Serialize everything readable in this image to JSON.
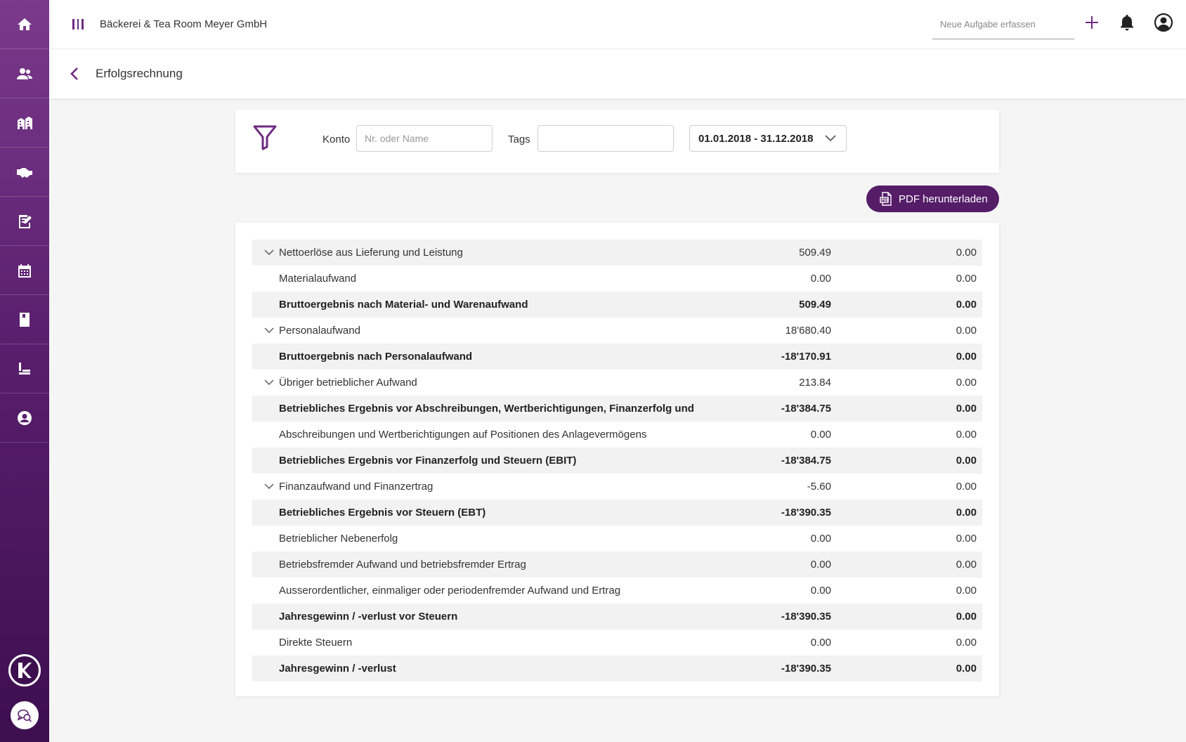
{
  "sidebar": {
    "items": [
      {
        "icon": "home-icon",
        "name": "home"
      },
      {
        "icon": "contacts-icon",
        "name": "contacts"
      },
      {
        "icon": "buildings-icon",
        "name": "companies"
      },
      {
        "icon": "handshake-icon",
        "name": "deals"
      },
      {
        "icon": "tasks-icon",
        "name": "tasks"
      },
      {
        "icon": "calendar-icon",
        "name": "calendar"
      },
      {
        "icon": "book-icon",
        "name": "accounting"
      },
      {
        "icon": "reports-icon",
        "name": "reports"
      },
      {
        "icon": "person-icon",
        "name": "profile"
      }
    ],
    "logo_icon": "k-logo-icon",
    "chat_icon": "chat-icon"
  },
  "topbar": {
    "company_name": "Bäckerei & Tea Room Meyer GmbH",
    "task_placeholder": "Neue Aufgabe erfassen"
  },
  "header": {
    "title": "Erfolgsrechnung"
  },
  "filter": {
    "konto_label": "Konto",
    "konto_placeholder": "Nr. oder Name",
    "tags_label": "Tags",
    "tags_value": "",
    "date_range": "01.01.2018 - 31.12.2018"
  },
  "pdf_button": {
    "label": "PDF herunterladen"
  },
  "colors": {
    "accent": "#551d68",
    "sidebar_top": "#7b3a8c",
    "sidebar_bottom": "#3d0f4f"
  },
  "rows": [
    {
      "label": "Nettoerlöse aus Lieferung und Leistung",
      "v1": "509.49",
      "v2": "0.00",
      "bold": false,
      "expandable": true
    },
    {
      "label": "Materialaufwand",
      "v1": "0.00",
      "v2": "0.00",
      "bold": false,
      "expandable": false
    },
    {
      "label": "Bruttoergebnis nach Material- und Warenaufwand",
      "v1": "509.49",
      "v2": "0.00",
      "bold": true,
      "expandable": false
    },
    {
      "label": "Personalaufwand",
      "v1": "18'680.40",
      "v2": "0.00",
      "bold": false,
      "expandable": true
    },
    {
      "label": "Bruttoergebnis nach Personalaufwand",
      "v1": "-18'170.91",
      "v2": "0.00",
      "bold": true,
      "expandable": false
    },
    {
      "label": "Übriger betrieblicher Aufwand",
      "v1": "213.84",
      "v2": "0.00",
      "bold": false,
      "expandable": true
    },
    {
      "label": "Betriebliches Ergebnis vor Abschreibungen, Wertberichtigungen, Finanzerfolg und Steuern (EBITDA)",
      "v1": "-18'384.75",
      "v2": "0.00",
      "bold": true,
      "expandable": false
    },
    {
      "label": "Abschreibungen und Wertberichtigungen auf Positionen des Anlagevermögens",
      "v1": "0.00",
      "v2": "0.00",
      "bold": false,
      "expandable": false
    },
    {
      "label": "Betriebliches Ergebnis vor Finanzerfolg und Steuern (EBIT)",
      "v1": "-18'384.75",
      "v2": "0.00",
      "bold": true,
      "expandable": false
    },
    {
      "label": "Finanzaufwand und Finanzertrag",
      "v1": "-5.60",
      "v2": "0.00",
      "bold": false,
      "expandable": true
    },
    {
      "label": "Betriebliches Ergebnis vor Steuern (EBT)",
      "v1": "-18'390.35",
      "v2": "0.00",
      "bold": true,
      "expandable": false
    },
    {
      "label": "Betrieblicher Nebenerfolg",
      "v1": "0.00",
      "v2": "0.00",
      "bold": false,
      "expandable": false
    },
    {
      "label": "Betriebsfremder Aufwand und betriebsfremder Ertrag",
      "v1": "0.00",
      "v2": "0.00",
      "bold": false,
      "expandable": false
    },
    {
      "label": "Ausserordentlicher, einmaliger oder periodenfremder Aufwand und Ertrag",
      "v1": "0.00",
      "v2": "0.00",
      "bold": false,
      "expandable": false
    },
    {
      "label": "Jahresgewinn / -verlust vor Steuern",
      "v1": "-18'390.35",
      "v2": "0.00",
      "bold": true,
      "expandable": false
    },
    {
      "label": "Direkte Steuern",
      "v1": "0.00",
      "v2": "0.00",
      "bold": false,
      "expandable": false
    },
    {
      "label": "Jahresgewinn / -verlust",
      "v1": "-18'390.35",
      "v2": "0.00",
      "bold": true,
      "expandable": false
    }
  ]
}
